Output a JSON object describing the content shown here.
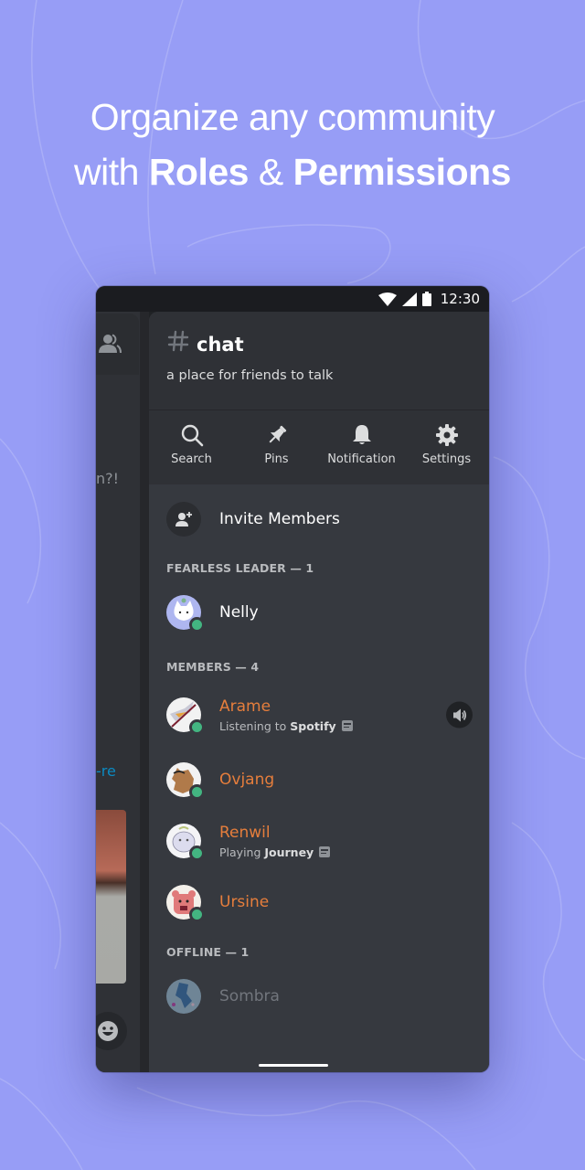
{
  "headline": {
    "line1": "Organize any community",
    "line2_prefix": "with ",
    "line2_bold1": "Roles",
    "line2_mid": " & ",
    "line2_bold2": "Permissions"
  },
  "status_bar": {
    "time": "12:30",
    "icons": [
      "wifi-icon",
      "cellular-signal-icon",
      "battery-icon"
    ]
  },
  "background_panel": {
    "icon": "people-icon",
    "partial_text": "n?!",
    "partial_link": "-re",
    "emoji_button_icon": "emoji-icon"
  },
  "channel": {
    "hash_icon": "hash-icon",
    "name": "chat",
    "topic": "a place for friends to talk"
  },
  "toolbar": [
    {
      "label": "Search",
      "icon": "search-icon"
    },
    {
      "label": "Pins",
      "icon": "pin-icon"
    },
    {
      "label": "Notification",
      "icon": "bell-icon"
    },
    {
      "label": "Settings",
      "icon": "gear-icon"
    }
  ],
  "invite": {
    "label": "Invite Members",
    "icon": "add-user-icon"
  },
  "sections": [
    {
      "title": "FEARLESS LEADER — 1",
      "members": [
        {
          "name": "Nelly",
          "status": "online",
          "role_color": "#ffffff"
        }
      ]
    },
    {
      "title": "MEMBERS — 4",
      "members": [
        {
          "name": "Arame",
          "status": "online",
          "role_color": "#e67e3c",
          "activity_prefix": "Listening to ",
          "activity_bold": "Spotify",
          "voice": true
        },
        {
          "name": "Ovjang",
          "status": "online",
          "role_color": "#e67e3c"
        },
        {
          "name": "Renwil",
          "status": "online",
          "role_color": "#e67e3c",
          "activity_prefix": "Playing ",
          "activity_bold": "Journey"
        },
        {
          "name": "Ursine",
          "status": "online",
          "role_color": "#e67e3c"
        }
      ]
    },
    {
      "title": "OFFLINE — 1",
      "members": [
        {
          "name": "Sombra",
          "status": "offline",
          "role_color": "#72767d"
        }
      ]
    }
  ],
  "colors": {
    "background": "#979df6",
    "drawer": "#36393f",
    "header": "#2f3136",
    "online": "#43b581",
    "role": "#e67e3c"
  }
}
